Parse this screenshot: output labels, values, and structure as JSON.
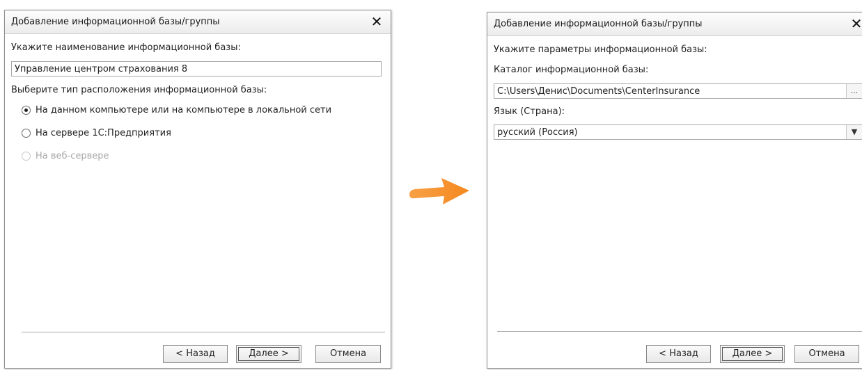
{
  "dialog_left": {
    "title": "Добавление информационной базы/группы",
    "close_glyph": "✕",
    "name_label": "Укажите наименование информационной базы:",
    "name_value": "Управление центром страхования 8",
    "location_label": "Выберите тип расположения информационной базы:",
    "location_options": [
      {
        "label": "На данном компьютере или на компьютере в локальной сети",
        "selected": true,
        "enabled": true
      },
      {
        "label": "На сервере 1С:Предприятия",
        "selected": false,
        "enabled": true
      },
      {
        "label": "На веб-сервере",
        "selected": false,
        "enabled": false
      }
    ],
    "buttons": {
      "back": "< Назад",
      "next": "Далее >",
      "cancel": "Отмена"
    }
  },
  "dialog_right": {
    "title": "Добавление информационной базы/группы",
    "close_glyph": "✕",
    "params_label": "Укажите параметры информационной базы:",
    "catalog_label": "Каталог информационной базы:",
    "catalog_value": "C:\\Users\\Денис\\Documents\\CenterInsurance",
    "browse_glyph": "...",
    "language_label": "Язык (Страна):",
    "language_value": "русский (Россия)",
    "dropdown_glyph": "▼",
    "buttons": {
      "back": "< Назад",
      "next": "Далее >",
      "cancel": "Отмена"
    }
  },
  "arrow": {
    "color": "#f5891f",
    "icon": "arrow-right-icon"
  }
}
